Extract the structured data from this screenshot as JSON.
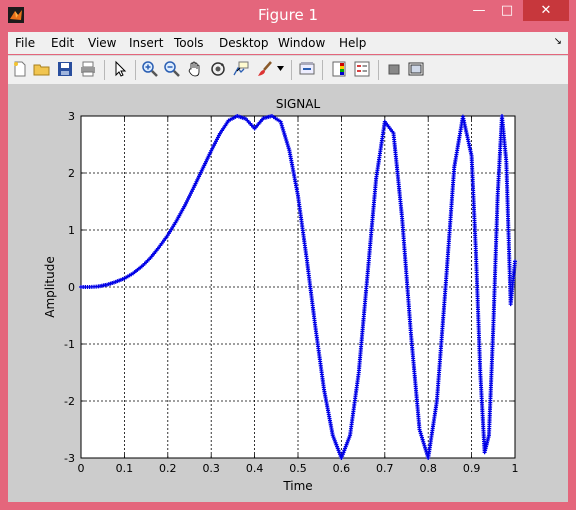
{
  "window": {
    "title": "Figure 1",
    "minimize_glyph": "—",
    "maximize_glyph": "□",
    "close_glyph": "✕"
  },
  "menubar": {
    "items": [
      "File",
      "Edit",
      "View",
      "Insert",
      "Tools",
      "Desktop",
      "Window",
      "Help"
    ],
    "dock_glyph": "↘"
  },
  "toolbar": {
    "icons": [
      "new-figure-icon",
      "open-file-icon",
      "save-icon",
      "print-icon",
      "edit-plot-arrow-icon",
      "zoom-in-icon",
      "zoom-out-icon",
      "pan-hand-icon",
      "rotate-3d-icon",
      "data-cursor-icon",
      "brush-icon",
      "brush-dropdown-icon",
      "link-plot-icon",
      "insert-colorbar-icon",
      "insert-legend-icon",
      "hide-plot-tools-icon",
      "show-plot-tools-icon"
    ]
  },
  "colors": {
    "accent": "#e4667c",
    "series": "#0000e6",
    "close": "#c7373c"
  },
  "chart_data": {
    "type": "scatter",
    "title": "SIGNAL",
    "xlabel": "Time",
    "ylabel": "Amplitude",
    "xlim": [
      0,
      1
    ],
    "ylim": [
      -3,
      3
    ],
    "xticks": [
      "0",
      "0.1",
      "0.2",
      "0.3",
      "0.4",
      "0.5",
      "0.6",
      "0.7",
      "0.8",
      "0.9",
      "1"
    ],
    "yticks": [
      "3",
      "2",
      "1",
      "0",
      "-1",
      "-2",
      "-3"
    ],
    "grid": true,
    "marker": "+",
    "series": [
      {
        "x": [
          0,
          0.02,
          0.04,
          0.06,
          0.08,
          0.1,
          0.12,
          0.14,
          0.16,
          0.18,
          0.2,
          0.22,
          0.24,
          0.26,
          0.28,
          0.3,
          0.32,
          0.34,
          0.36,
          0.38,
          0.4,
          0.42,
          0.44,
          0.46,
          0.48,
          0.5,
          0.52,
          0.54,
          0.56,
          0.58,
          0.6,
          0.62,
          0.64,
          0.66,
          0.68,
          0.7,
          0.72,
          0.74,
          0.76,
          0.78,
          0.8,
          0.82,
          0.84,
          0.86,
          0.88,
          0.9,
          0.91,
          0.92,
          0.93,
          0.94,
          0.95,
          0.96,
          0.97,
          0.98,
          0.99,
          1.0
        ],
        "y": [
          0,
          0,
          0.01,
          0.04,
          0.09,
          0.15,
          0.24,
          0.36,
          0.51,
          0.7,
          0.91,
          1.16,
          1.44,
          1.75,
          2.07,
          2.39,
          2.69,
          2.92,
          3,
          2.95,
          2.78,
          2.96,
          3,
          2.9,
          2.4,
          1.6,
          0.5,
          -0.7,
          -1.8,
          -2.6,
          -3,
          -2.6,
          -1.5,
          0.2,
          1.9,
          2.9,
          2.7,
          1.2,
          -0.8,
          -2.5,
          -3,
          -2.0,
          0,
          2.1,
          2.99,
          2.3,
          0.6,
          -1.5,
          -2.9,
          -2.6,
          -0.7,
          1.6,
          3,
          2.2,
          -0.3,
          0.45
        ]
      }
    ]
  }
}
